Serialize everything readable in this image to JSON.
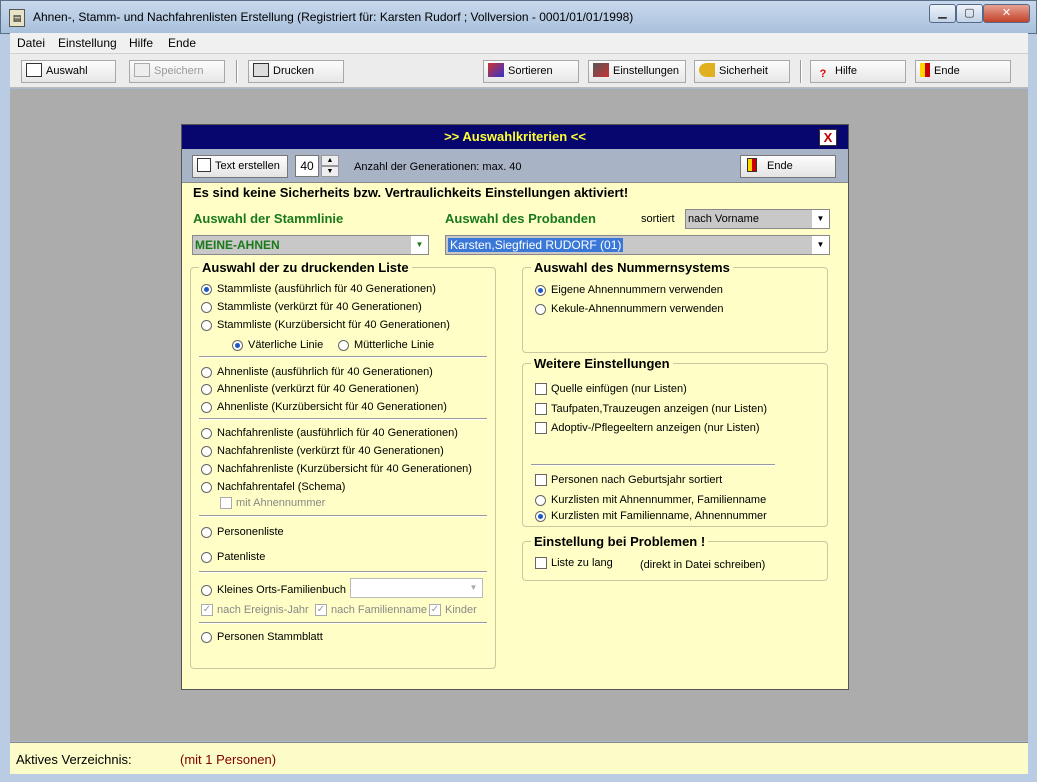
{
  "window": {
    "title": "Ahnen-, Stamm- und Nachfahrenlisten Erstellung  (Registriert für: Karsten Rudorf ; Vollversion - 0001/01/01/1998)",
    "app_icon_text": "▤",
    "min": "▁",
    "max": "▢",
    "close": "✕"
  },
  "menu": [
    "Datei",
    "Einstellung",
    "Hilfe",
    "Ende"
  ],
  "toolbar": {
    "auswahl": "Auswahl",
    "speichern": "Speichern",
    "drucken": "Drucken",
    "sortieren": "Sortieren",
    "einstellungen": "Einstellungen",
    "sicherheit": "Sicherheit",
    "hilfe": "Hilfe",
    "ende": "Ende"
  },
  "status": {
    "label": "Aktives Verzeichnis:",
    "value": "(mit 1 Personen)"
  },
  "dialog": {
    "title": ">> Auswahlkriterien <<",
    "close": "X",
    "text_erstellen": "Text erstellen",
    "generations": "40",
    "gen_label": "Anzahl der Generationen: max. 40",
    "ende": "Ende",
    "security_msg": "Es sind keine Sicherheits bzw. Vertraulichkeits Einstellungen aktiviert!",
    "stammlinie_h": "Auswahl der Stammlinie",
    "stammlinie_value": "MEINE-AHNEN",
    "probanden_h": "Auswahl des Probanden",
    "sortiert": "sortiert",
    "sort_value": "nach Vorname",
    "proband_value": "Karsten,Siegfried RUDORF  (01)",
    "liste_h": "Auswahl der zu druckenden Liste",
    "liste": {
      "stamm1": "Stammliste (ausführlich für 40 Generationen)",
      "stamm2": "Stammliste (verkürzt für 40 Generationen)",
      "stamm3": "Stammliste (Kurzübersicht für 40 Generationen)",
      "vater": "Väterliche Linie",
      "mutter": "Mütterliche Linie",
      "ahnen1": "Ahnenliste (ausführlich für 40 Generationen)",
      "ahnen2": "Ahnenliste (verkürzt für 40 Generationen)",
      "ahnen3": "Ahnenliste (Kurzübersicht für 40 Generationen)",
      "nach1": "Nachfahrenliste (ausführlich für 40 Generationen)",
      "nach2": "Nachfahrenliste (verkürzt für 40 Generationen)",
      "nach3": "Nachfahrenliste (Kurzübersicht für 40 Generationen)",
      "tafel": "Nachfahrentafel (Schema)",
      "mit_ahnen": "mit Ahnennummer",
      "personen": "Personenliste",
      "paten": "Patenliste",
      "orts": "Kleines Orts-Familienbuch",
      "ereignis": "nach Ereignis-Jahr",
      "familie": "nach Familienname",
      "kinder": "Kinder",
      "stammblatt": "Personen Stammblatt"
    },
    "nummern_h": "Auswahl des Nummernsystems",
    "nummern1": "Eigene Ahnennummern verwenden",
    "nummern2": "Kekule-Ahnennummern verwenden",
    "weitere_h": "Weitere Einstellungen",
    "weitere": {
      "quelle": "Quelle einfügen (nur Listen)",
      "taufpaten": "Taufpaten,Trauzeugen anzeigen (nur Listen)",
      "adoptiv": "Adoptiv-/Pflegeeltern anzeigen (nur Listen)",
      "geburt": "Personen nach Geburtsjahr sortiert",
      "kurz1": "Kurzlisten mit Ahnennummer, Familienname",
      "kurz2": "Kurzlisten mit Familienname, Ahnennummer"
    },
    "problem_h": "Einstellung bei Problemen !",
    "zu_lang": "Liste zu lang",
    "direkt": "(direkt in Datei schreiben)"
  }
}
